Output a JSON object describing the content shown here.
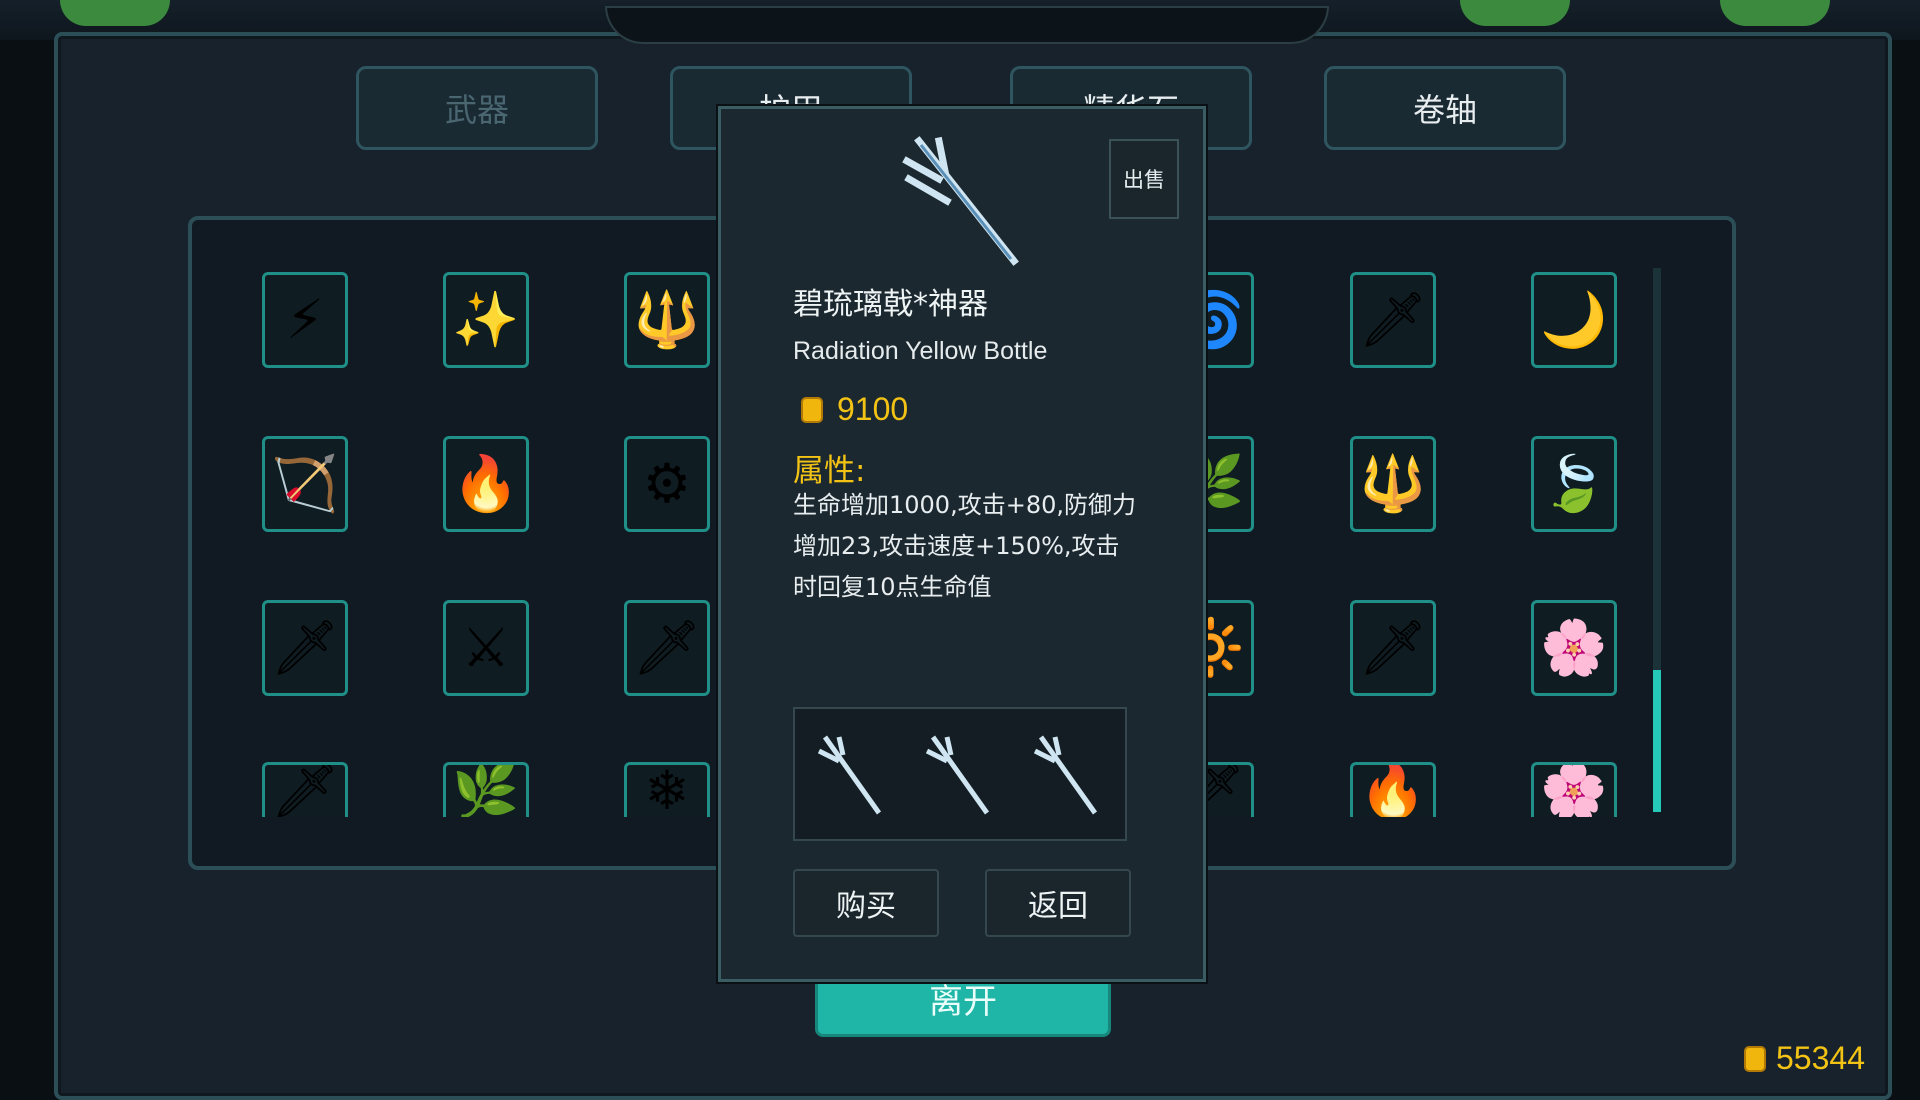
{
  "tabs": [
    {
      "label": "武器"
    },
    {
      "label": "护甲"
    },
    {
      "label": "精华石"
    },
    {
      "label": "卷轴"
    }
  ],
  "leave_button": {
    "label": "离开"
  },
  "grid": {
    "left_columns": [
      [
        "⚡",
        "🏹",
        "🗡",
        "🗡"
      ],
      [
        "✨",
        "🔥",
        "⚔",
        "🌿"
      ],
      [
        "🔱",
        "⚙",
        "🗡",
        "❄"
      ]
    ],
    "right_columns": [
      [
        "🌀",
        "🌿",
        "🔆",
        "🗡"
      ],
      [
        "🗡",
        "🔱",
        "🗡",
        "🔥"
      ],
      [
        "🌙",
        "🍃",
        "🌸",
        "🌸"
      ]
    ],
    "scroll_position": 0.74
  },
  "item_modal": {
    "sell_label": "出售",
    "name": "碧琉璃戟*神器",
    "subtitle": "Radiation Yellow Bottle",
    "price": "9100",
    "attributes_label": "属性:",
    "attributes_line1": "生命增加1000,攻击+80,防御力",
    "attributes_line2": "增加23,攻击速度+150%,攻击",
    "attributes_line3": "时回复10点生命值",
    "buy_label": "购买",
    "back_label": "返回"
  },
  "player": {
    "gold": "55344"
  },
  "colors": {
    "accent": "#1fb5a7",
    "gold": "#f2c315",
    "slot_border": "#1f8f88"
  }
}
